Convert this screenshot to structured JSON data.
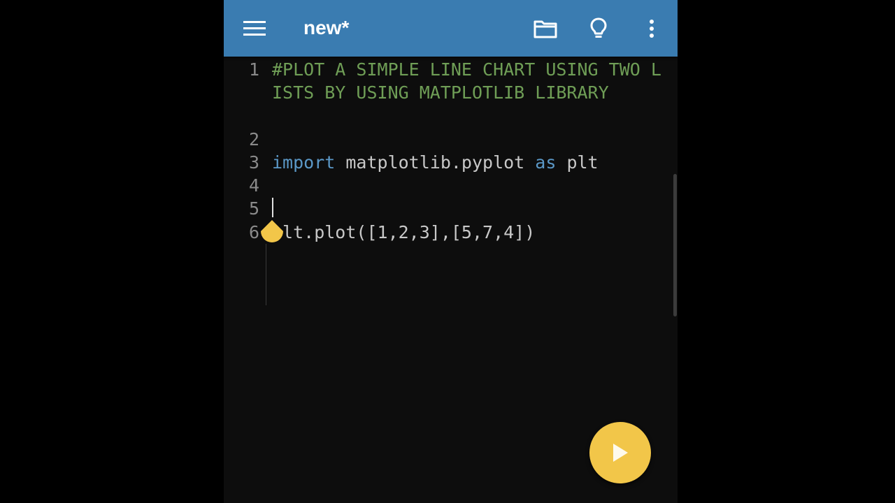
{
  "appbar": {
    "title": "new*",
    "icons": [
      "menu-icon",
      "folder-icon",
      "lightbulb-icon",
      "more-vert-icon"
    ],
    "background": "#3a7cb1"
  },
  "editor": {
    "lines": [
      {
        "number": "1",
        "text": "#PLOT A SIMPLE LINE CHART USING TWO LISTS BY USING MATPLOTLIB LIBRARY"
      },
      {
        "number": "2",
        "text": ""
      },
      {
        "number": "3",
        "kw1": "import",
        "module": " matplotlib.pyplot ",
        "kw2": "as",
        "alias": " plt"
      },
      {
        "number": "4",
        "text": ""
      },
      {
        "number": "5",
        "text": ""
      },
      {
        "number": "6",
        "text": "plt.plot([1,2,3],[5,7,4])"
      }
    ],
    "colors": {
      "comment": "#6f9e56",
      "keyword": "#5b98c7",
      "text": "#c8c8c8"
    }
  },
  "fab": {
    "icon": "play-icon",
    "color": "#f2c649"
  }
}
